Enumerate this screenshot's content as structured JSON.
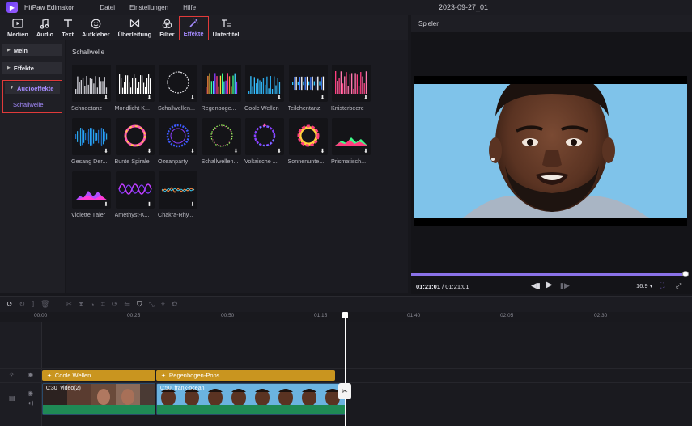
{
  "app": {
    "name": "HitPaw Edimakor",
    "project_title": "2023-09-27_01"
  },
  "menu": [
    "Datei",
    "Einstellungen",
    "Hilfe"
  ],
  "toolbar": {
    "items": [
      {
        "label": "Medien",
        "icon": "media-icon"
      },
      {
        "label": "Audio",
        "icon": "music-note-icon"
      },
      {
        "label": "Text",
        "icon": "text-icon"
      },
      {
        "label": "Aufkleber",
        "icon": "sticker-icon"
      },
      {
        "label": "Überleitung",
        "icon": "transition-icon"
      },
      {
        "label": "Filter",
        "icon": "filter-icon"
      },
      {
        "label": "Effekte",
        "icon": "magic-wand-icon"
      },
      {
        "label": "Untertitel",
        "icon": "subtitle-icon"
      }
    ],
    "active": "Effekte",
    "accent": "#a58bff",
    "highlight": "#e03a3a"
  },
  "sidebar": {
    "groups": [
      "Mein",
      "Effekte",
      "Audioeffekte"
    ],
    "active_sub": "Schallwelle"
  },
  "effects": {
    "section_title": "Schallwelle",
    "items": [
      {
        "label": "Schneetanz"
      },
      {
        "label": "Mondlicht K..."
      },
      {
        "label": "Schallwellen..."
      },
      {
        "label": "Regenboge..."
      },
      {
        "label": "Coole Wellen"
      },
      {
        "label": "Teilchentanz"
      },
      {
        "label": "Knisterbeere"
      },
      {
        "label": "Gesang Der..."
      },
      {
        "label": "Bunte Spirale"
      },
      {
        "label": "Ozeanparty"
      },
      {
        "label": "Schallwellen..."
      },
      {
        "label": "Voltaische ..."
      },
      {
        "label": "Sonnenunte..."
      },
      {
        "label": "Prismatisch..."
      },
      {
        "label": "Violette Täler"
      },
      {
        "label": "Amethyst-K..."
      },
      {
        "label": "Chakra-Rhy..."
      }
    ]
  },
  "player": {
    "title": "Spieler",
    "current_time": "01:21:01",
    "total_time": "01:21:01",
    "progress": 1.0,
    "aspect": "16:9"
  },
  "timeline": {
    "ruler": [
      "00:00",
      "00:25",
      "00:50",
      "01:15",
      "01:40",
      "02:05",
      "02:30"
    ],
    "fx_clips": [
      {
        "label": "Coole Wellen"
      },
      {
        "label": "Regenbogen-Pops"
      }
    ],
    "video_clips": [
      {
        "duration": "0:30",
        "name": "video(2)"
      },
      {
        "duration": "0:50",
        "name": "frank-ocean"
      }
    ]
  }
}
